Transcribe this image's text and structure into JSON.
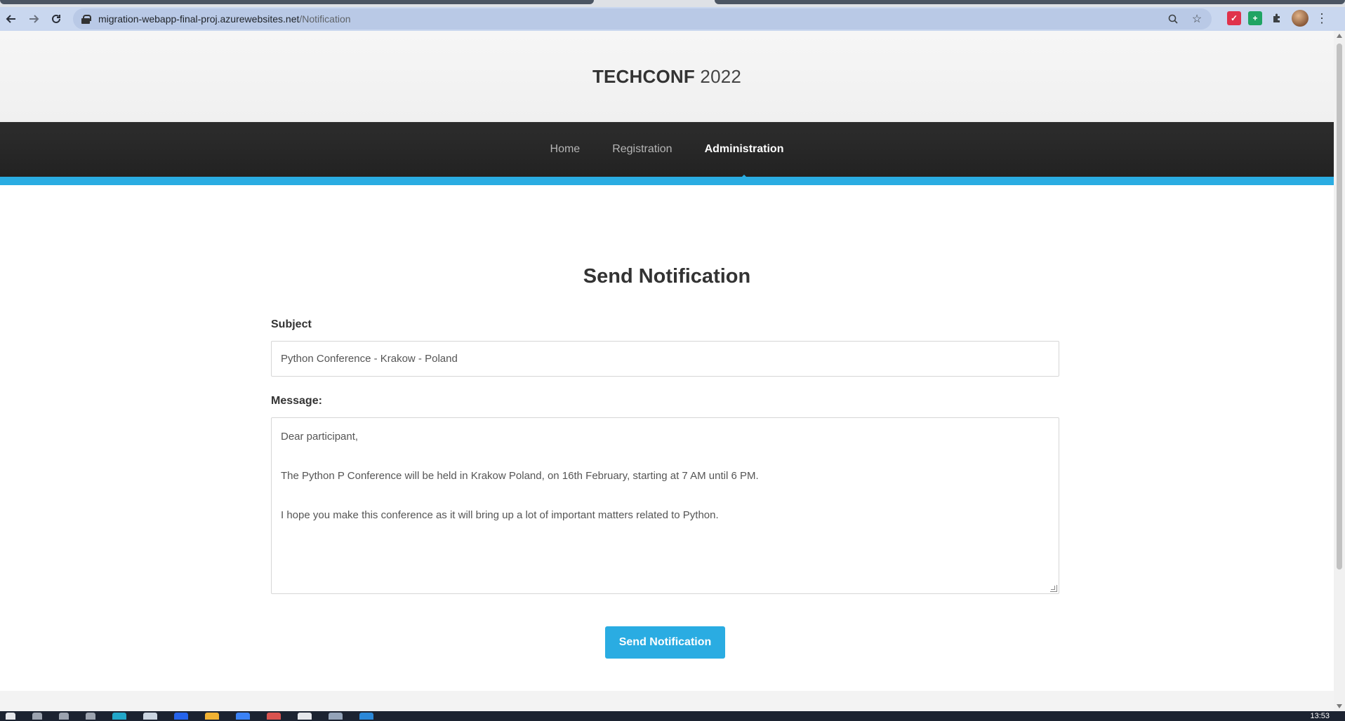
{
  "browser": {
    "url_host": "migration-webapp-final-proj.azurewebsites.net",
    "url_path": "/Notification"
  },
  "site": {
    "brand_bold": "TECHCONF",
    "brand_light": " 2022",
    "nav": [
      {
        "label": "Home",
        "active": false
      },
      {
        "label": "Registration",
        "active": false
      },
      {
        "label": "Administration",
        "active": true
      }
    ]
  },
  "page": {
    "title": "Send Notification",
    "subject_label": "Subject",
    "subject_value": "Python Conference - Krakow - Poland",
    "message_label": "Message:",
    "message_lines": [
      "Dear participant,",
      "The Python P Conference will be held in Krakow Poland, on 16th February, starting at 7 AM until 6 PM.",
      "I hope you make this conference as it will bring up a lot of important matters related to Python."
    ],
    "submit_label": "Send Notification"
  },
  "taskbar": {
    "clock": "13:53"
  },
  "colors": {
    "accent": "#2aace2",
    "nav_bg": "#222222"
  }
}
